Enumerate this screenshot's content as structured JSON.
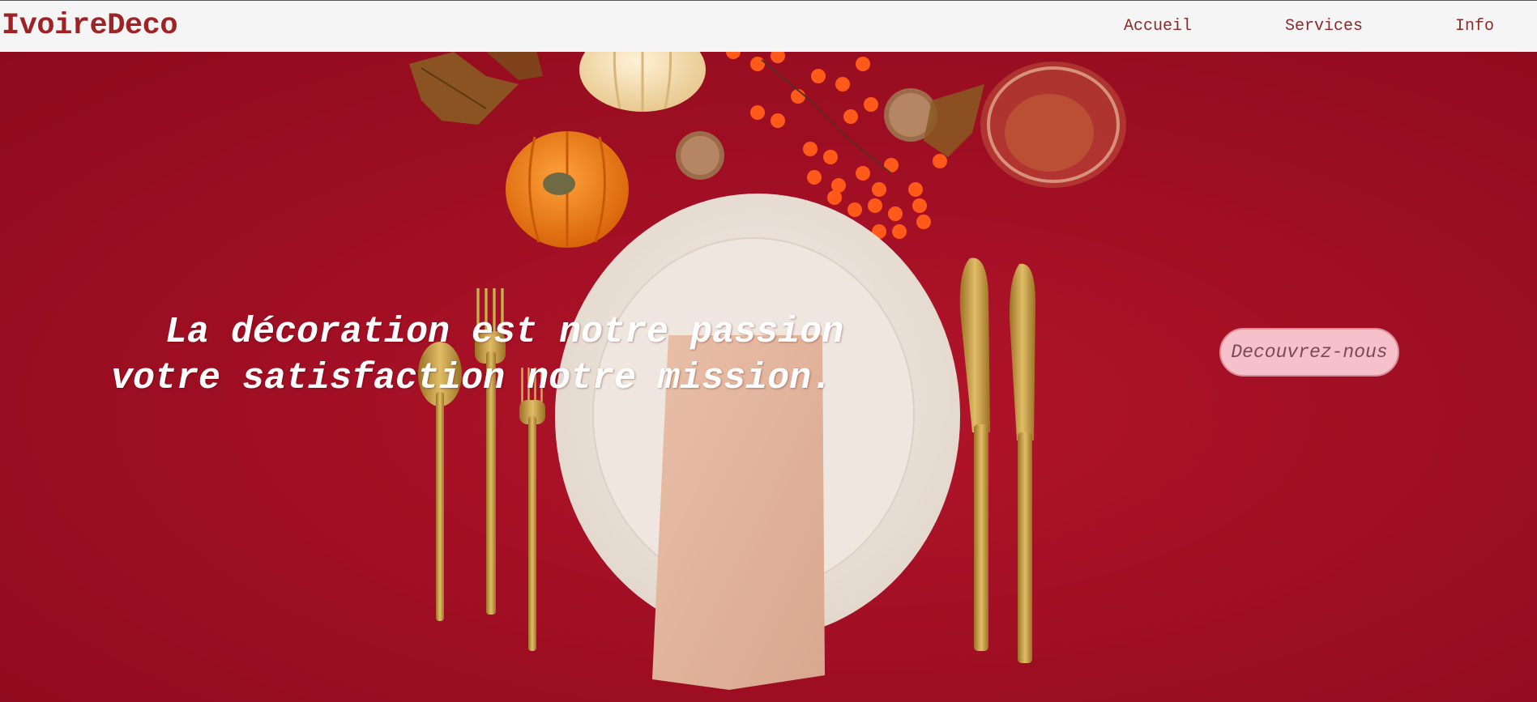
{
  "header": {
    "brand": "IvoireDeco",
    "nav": [
      {
        "label": "Accueil"
      },
      {
        "label": "Services"
      },
      {
        "label": "Info"
      }
    ]
  },
  "hero": {
    "headline_line1": "La décoration est notre passion",
    "headline_line2": "votre satisfaction notre mission.",
    "cta_label": "Decouvrez-nous",
    "background_image": "autumn-table-setting-photo"
  },
  "colors": {
    "brand": "#9e2226",
    "nav_text": "#8b2a2a",
    "hero_red": "#a10f24",
    "cta_bg": "#f6c1ca",
    "topbar_bg": "#f5f5f5"
  }
}
